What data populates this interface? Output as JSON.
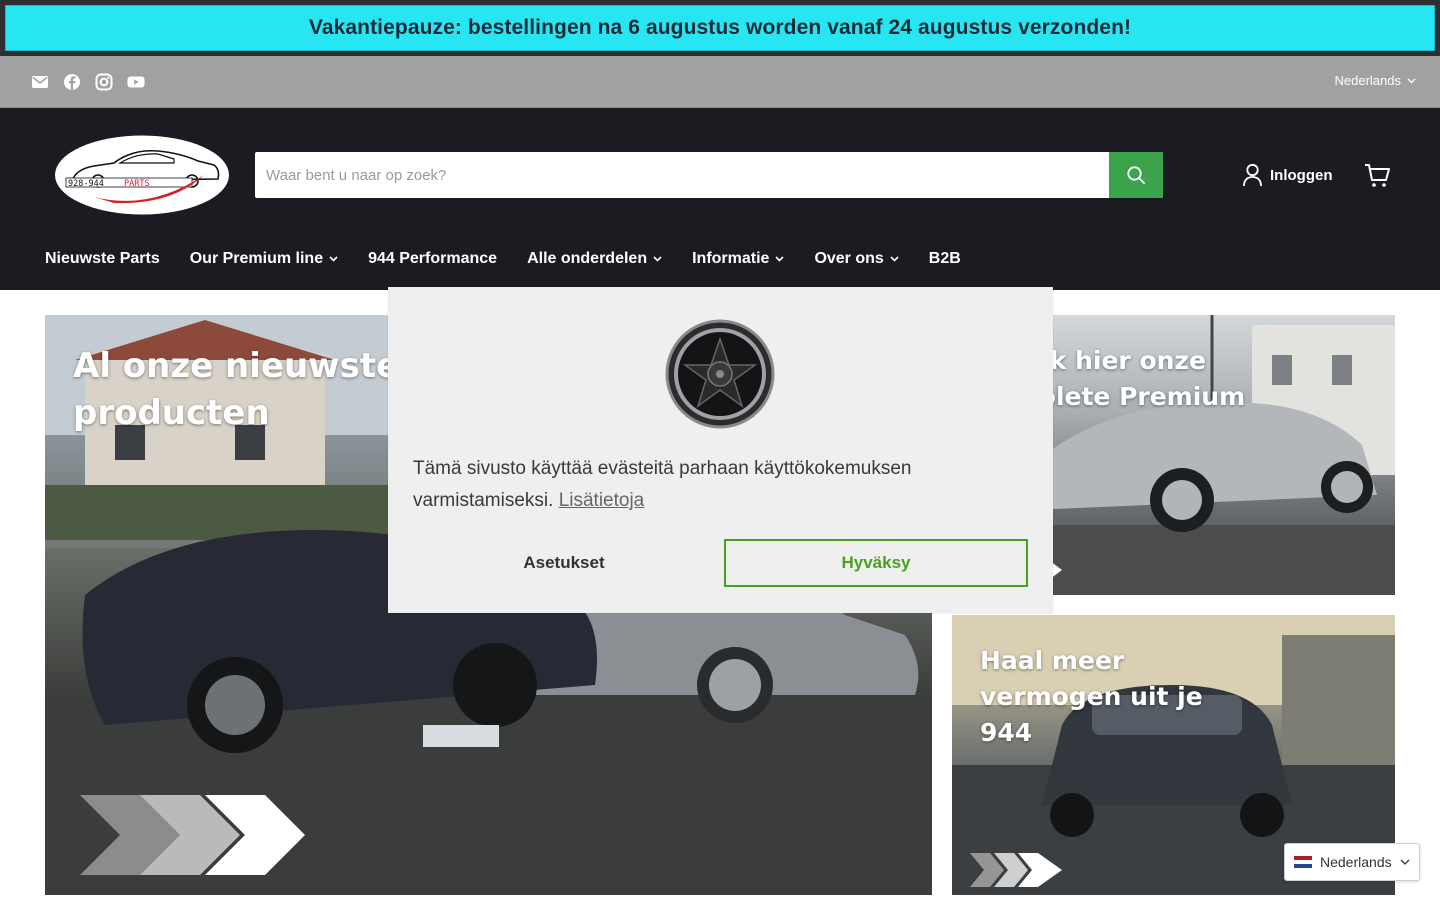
{
  "announcement": {
    "text": "Vakantiepauze: bestellingen na 6 augustus worden vanaf 24 augustus verzonden!"
  },
  "utility": {
    "social_icons": [
      "email-icon",
      "facebook-icon",
      "instagram-icon",
      "youtube-icon"
    ],
    "language": "Nederlands"
  },
  "header": {
    "logo_text": "928-944PARTS",
    "search_placeholder": "Waar bent u naar op zoek?",
    "login_label": "Inloggen"
  },
  "nav": {
    "items": [
      {
        "label": "Nieuwste Parts",
        "dropdown": false
      },
      {
        "label": "Our Premium line",
        "dropdown": true
      },
      {
        "label": "944 Performance",
        "dropdown": false
      },
      {
        "label": "Alle onderdelen",
        "dropdown": true
      },
      {
        "label": "Informatie",
        "dropdown": true
      },
      {
        "label": "Over ons",
        "dropdown": true
      },
      {
        "label": "B2B",
        "dropdown": false
      }
    ]
  },
  "hero": {
    "main_title": "Al onze nieuwste producten",
    "top_right_title": "Bekijk hier onze complete Premium",
    "bottom_right_title": "Haal meer vermogen uit je 944"
  },
  "cookie": {
    "text": "Tämä sivusto käyttää evästeitä parhaan käyttökokemuksen varmistamiseksi.",
    "link": "Lisätietoja",
    "settings_label": "Asetukset",
    "accept_label": "Hyväksy"
  },
  "language_switcher": {
    "label": "Nederlands"
  },
  "colors": {
    "announcement_bg": "#27e6f2",
    "header_bg": "#1c1b22",
    "search_button": "#3aa34b",
    "accept_green": "#4aa021"
  }
}
